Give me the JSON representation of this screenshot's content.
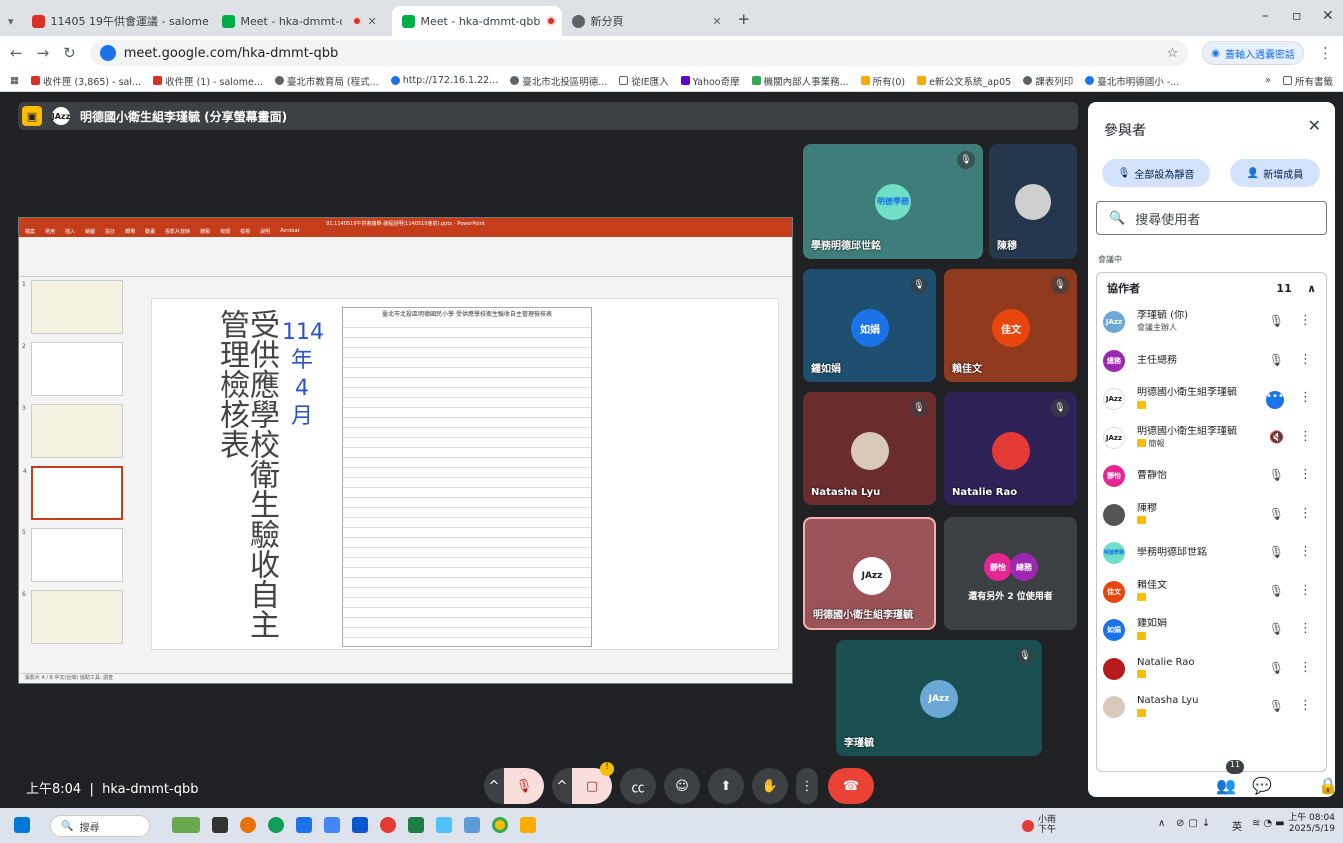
{
  "tabs": [
    {
      "title": "11405 19午供會運議 - salome",
      "active": false,
      "favicon_color": "#d93025"
    },
    {
      "title": "Meet - hka-dmmt-qbb",
      "active": false,
      "favicon_color": "#00ac47"
    },
    {
      "title": "Meet - hka-dmmt-qbb",
      "active": true,
      "favicon_color": "#00ac47"
    },
    {
      "title": "新分頁",
      "active": false,
      "favicon_color": "#5f6368"
    }
  ],
  "address": {
    "url": "meet.google.com/hka-dmmt-qbb",
    "translate_label": "蓋軸入遇囊密話"
  },
  "bookmarks": [
    "收件匣 (3,865) - sal...",
    "收件匣 (1) - salome...",
    "臺北市教育局 (程式...",
    "http://172.16.1.22...",
    "臺北市北投區明德...",
    "從IE匯入",
    "Yahoo奇摩",
    "機關內部人事業務...",
    "所有(0)",
    "e新公文系統_ap05",
    "課表列印",
    "臺北市明德國小 -..."
  ],
  "bookmarks_right": "所有書籤",
  "presenter": {
    "label": "明德國小衛生組李瑾毓 (分享螢幕畫面)",
    "avatar_text": "JAzz"
  },
  "slide": {
    "vertical_title": "受供應學校衛生驗收自主管理檢核表",
    "year": "114",
    "year_unit": "年",
    "month": "4",
    "month_unit": "月",
    "doc_header": "臺北市北投區明德國民小學 受供應學校衛生驗收自主管理檢核表"
  },
  "ppt": {
    "title": "01.1140519午供會議單-議程說明(1140519會前).pptx - PowerPoint",
    "tabs": [
      "檔案",
      "常用",
      "插入",
      "繪圖",
      "設計",
      "轉場",
      "動畫",
      "投影片放映",
      "錄製",
      "校閱",
      "檢視",
      "說明",
      "Acrobat"
    ],
    "status": "投影片 4 / 8   中文(台灣)   協助工具: 調查"
  },
  "tiles": [
    {
      "name": "學務明德邱世銘",
      "avatar": "明德學務",
      "bg": "#3f7d7a",
      "av_bg": "#6fe0c7"
    },
    {
      "name": "陳穆",
      "avatar": "",
      "bg": "#24374d",
      "av_bg": "#cfcfcf"
    },
    {
      "name": "鍾如娟",
      "avatar": "如娟",
      "bg": "#1f4f70",
      "av_bg": "#1a73e8"
    },
    {
      "name": "賴佳文",
      "avatar": "佳文",
      "bg": "#8f3a1f",
      "av_bg": "#e8460c"
    },
    {
      "name": "Natasha Lyu",
      "avatar": "",
      "bg": "#6b2c2e",
      "av_bg": "#d9c9b8"
    },
    {
      "name": "Natalie Rao",
      "avatar": "",
      "bg": "#2e2156",
      "av_bg": "#e53935"
    },
    {
      "name": "明德國小衛生組李瑾毓",
      "avatar": "JAzz",
      "bg": "#9a5457",
      "av_bg": "#ffffff"
    },
    {
      "name": "還有另外 2 位使用者",
      "avatar": "靜怡",
      "avatar2": "總務",
      "bg": "#3c4043",
      "av_bg": "#e52592",
      "av_bg2": "#9c27b0"
    },
    {
      "name": "李瑾毓",
      "avatar": "JAzz",
      "bg": "#1a4f52",
      "av_bg": "#6ba8d6"
    }
  ],
  "panel": {
    "title": "參與者",
    "mute_all_label": "全部設為靜音",
    "add_people_label": "新增成員",
    "search_placeholder": "搜尋使用者",
    "in_meeting_label": "會議中",
    "group_label": "協作者",
    "group_count": "11",
    "participants": [
      {
        "name": "李瑾毓 (你)",
        "sub": "會議主辦人",
        "av": "JAzz",
        "av_bg": "#6ba8d6",
        "chip": false
      },
      {
        "name": "主任總務",
        "sub": "",
        "av": "總務",
        "av_bg": "#9c27b0",
        "chip": false
      },
      {
        "name": "明德國小衛生組李瑾毓",
        "sub": "",
        "av": "JAzz",
        "av_bg": "#ffffff",
        "chip": true
      },
      {
        "name": "明德國小衛生組李瑾毓",
        "sub": "簡報",
        "av": "JAzz",
        "av_bg": "#ffffff",
        "chip": true
      },
      {
        "name": "曹靜怡",
        "sub": "",
        "av": "靜怡",
        "av_bg": "#e52592",
        "chip": false
      },
      {
        "name": "陳穆",
        "sub": "",
        "av": "",
        "av_bg": "#555555",
        "chip": true
      },
      {
        "name": "學務明德邱世銘",
        "sub": "",
        "av": "明德學務",
        "av_bg": "#6fe0c7",
        "chip": false
      },
      {
        "name": "賴佳文",
        "sub": "",
        "av": "佳文",
        "av_bg": "#e8460c",
        "chip": true
      },
      {
        "name": "鍾如娟",
        "sub": "",
        "av": "如娟",
        "av_bg": "#1a73e8",
        "chip": true
      },
      {
        "name": "Natalie Rao",
        "sub": "",
        "av": "",
        "av_bg": "#b71c1c",
        "chip": true
      },
      {
        "name": "Natasha Lyu",
        "sub": "",
        "av": "",
        "av_bg": "#d9c9b8",
        "chip": true
      }
    ]
  },
  "meeting": {
    "time": "上午8:04",
    "code": "hka-dmmt-qbb",
    "people_badge": "11"
  },
  "taskbar": {
    "search_label": "搜尋",
    "weather": "小雨",
    "weather_sub": "下午",
    "lang": "英",
    "clock_time": "上午 08:04",
    "clock_date": "2025/5/19"
  },
  "accent": "#1a73e8",
  "hangup_color": "#ea4335"
}
